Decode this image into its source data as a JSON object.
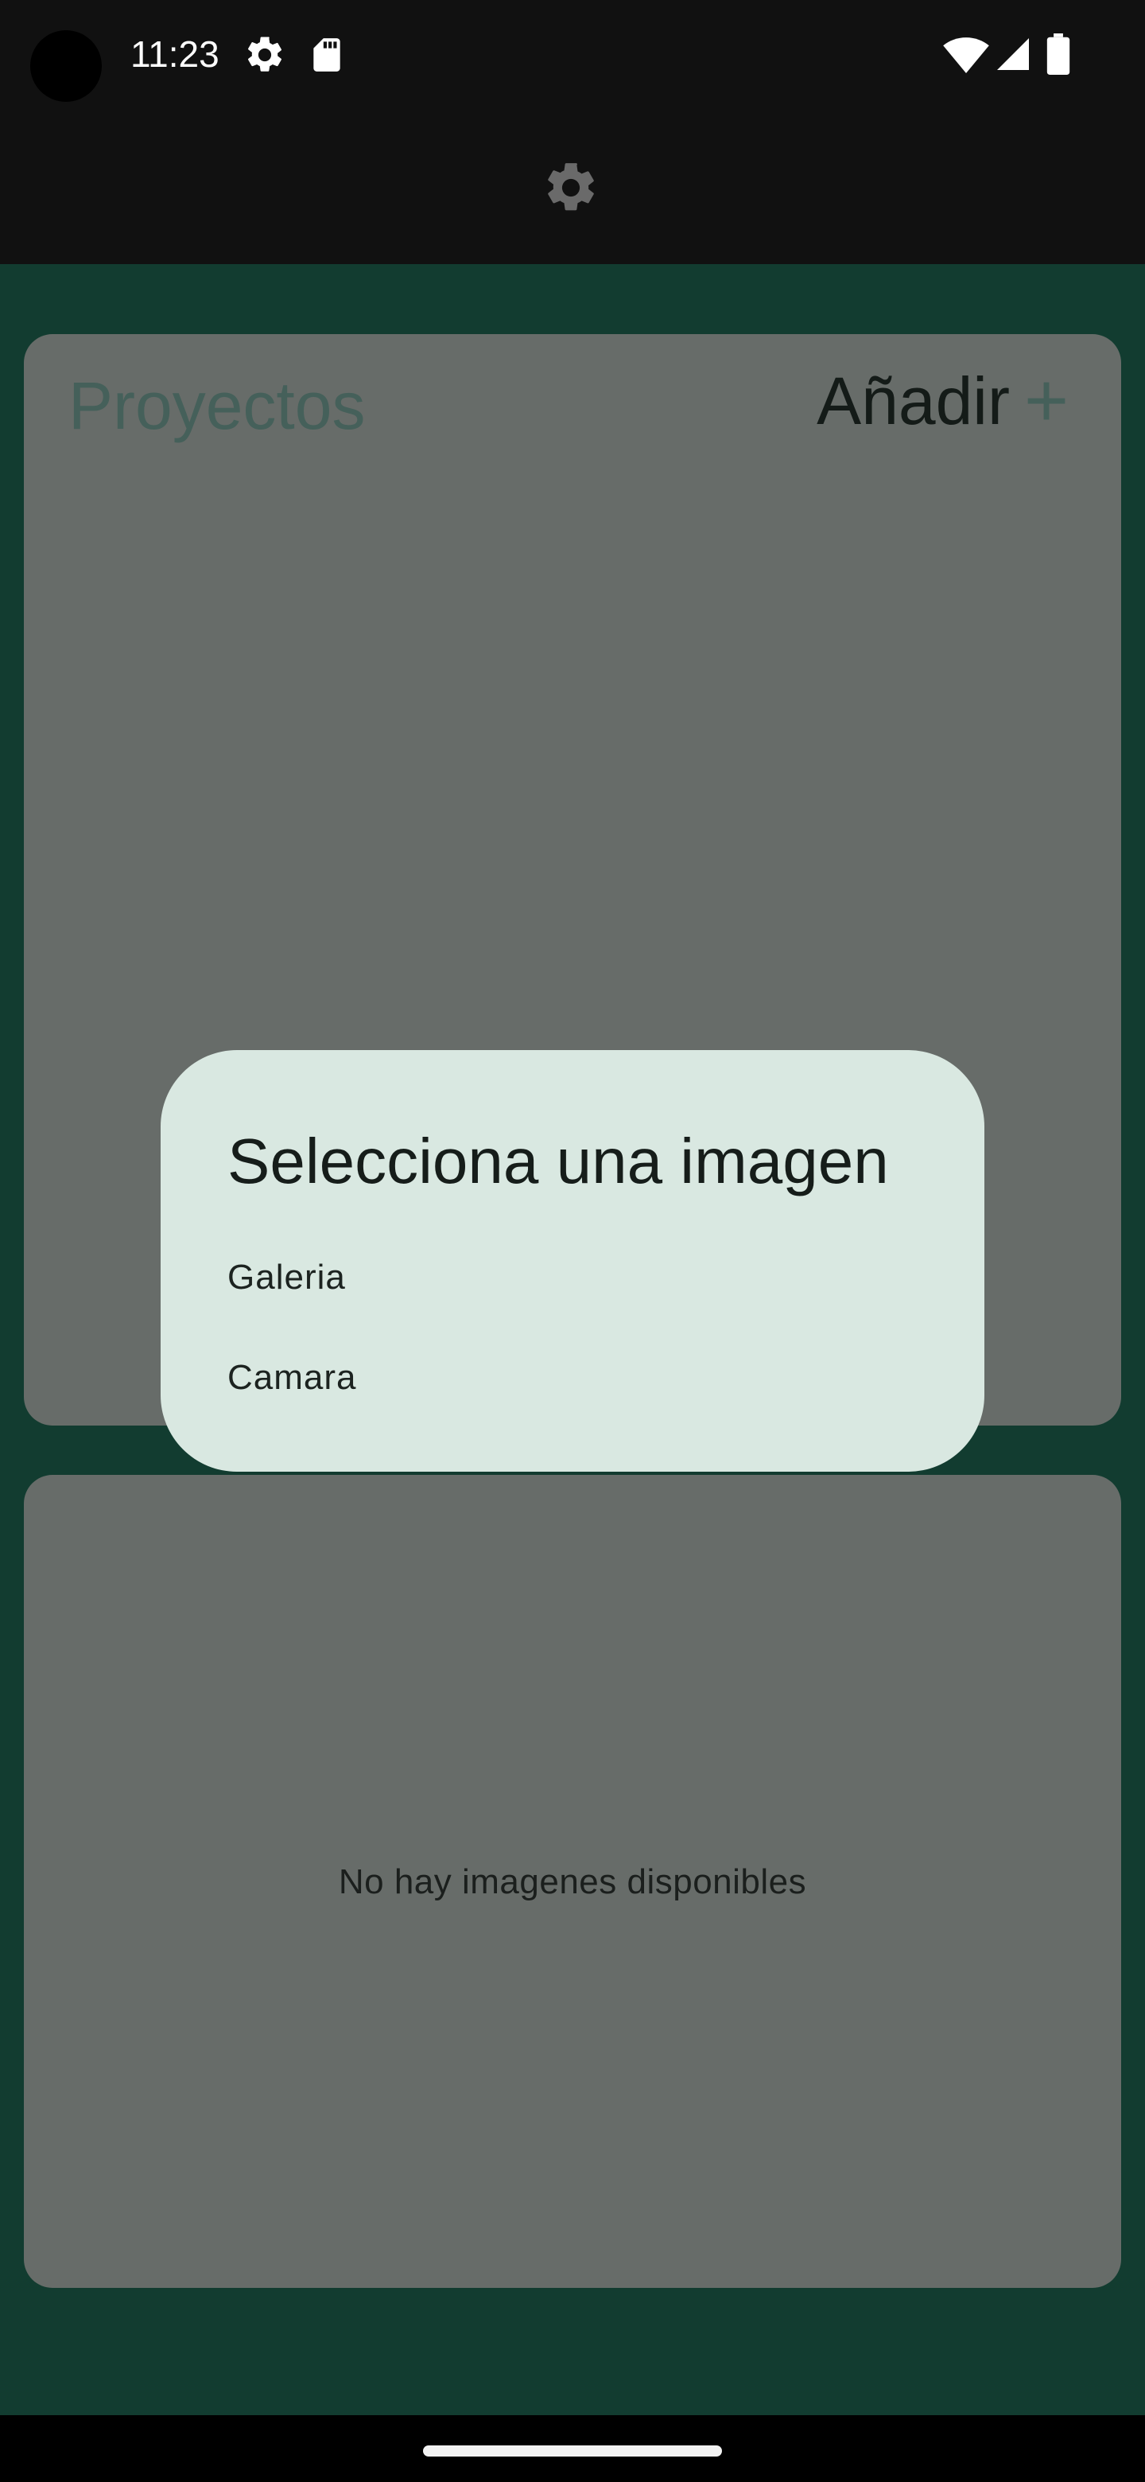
{
  "status_bar": {
    "time": "11:23",
    "icons": [
      "settings-gear-icon",
      "sd-card-icon",
      "wifi-icon",
      "signal-icon",
      "battery-icon"
    ]
  },
  "app_bar": {
    "settings_icon": "gear-icon"
  },
  "projects": {
    "title": "Proyectos",
    "add_label": "Añadir",
    "add_icon": "+"
  },
  "images": {
    "empty_message": "No hay imagenes disponibles"
  },
  "dialog": {
    "title": "Selecciona una imagen",
    "options": [
      "Galeria",
      "Camara"
    ]
  },
  "colors": {
    "status_bar_bg": "#111111",
    "content_bg": "#123c30",
    "card_bg": "#676c69",
    "dialog_bg": "#d9e8e1",
    "accent_text": "#45605a"
  }
}
